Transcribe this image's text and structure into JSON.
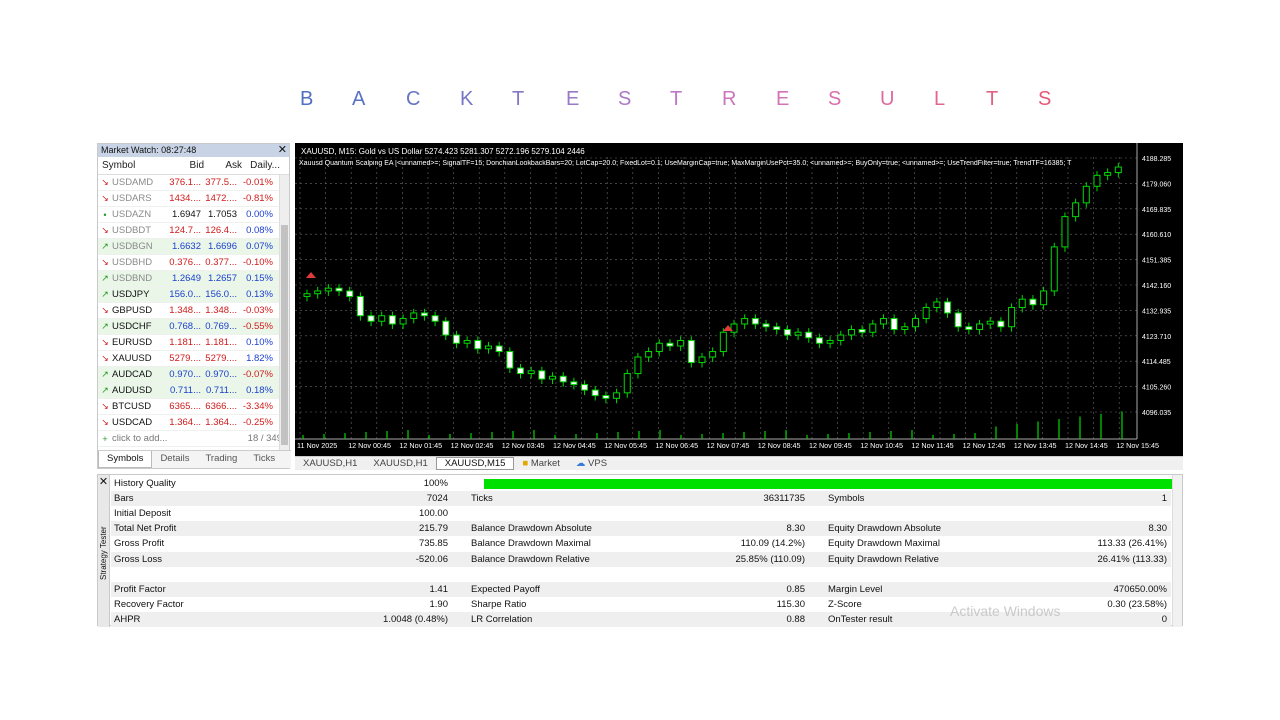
{
  "heading": {
    "letters": [
      "B",
      "A",
      "C",
      "K",
      "T",
      "E",
      "S",
      "T",
      "R",
      "E",
      "S",
      "U",
      "L",
      "T",
      "S"
    ],
    "colors": [
      "#4f6fc0",
      "#5a70c2",
      "#6774c4",
      "#7577c6",
      "#8579c6",
      "#9a7ac8",
      "#ab79c8",
      "#bb78c6",
      "#c876bf",
      "#d274b7",
      "#d86fac",
      "#df6a9f",
      "#e26592",
      "#e36084",
      "#e55a78"
    ]
  },
  "market_watch": {
    "title": "Market Watch: 08:27:48",
    "close": "✕",
    "columns": [
      "Symbol",
      "Bid",
      "Ask",
      "Daily..."
    ],
    "rows": [
      {
        "symbol": "USDAMD",
        "bid": "376.1...",
        "ask": "377.5...",
        "change": "-0.01%",
        "dir": "down"
      },
      {
        "symbol": "USDARS",
        "bid": "1434....",
        "ask": "1472....",
        "change": "-0.81%",
        "dir": "down"
      },
      {
        "symbol": "USDAZN",
        "bid": "1.6947",
        "ask": "1.7053",
        "change": "0.00%",
        "dir": "flat"
      },
      {
        "symbol": "USDBDT",
        "bid": "124.7...",
        "ask": "126.4...",
        "change": "0.08%",
        "dir": "down"
      },
      {
        "symbol": "USDBGN",
        "bid": "1.6632",
        "ask": "1.6696",
        "change": "0.07%",
        "dir": "up"
      },
      {
        "symbol": "USDBHD",
        "bid": "0.376...",
        "ask": "0.377...",
        "change": "-0.10%",
        "dir": "down"
      },
      {
        "symbol": "USDBND",
        "bid": "1.2649",
        "ask": "1.2657",
        "change": "0.15%",
        "dir": "up"
      },
      {
        "symbol": "USDJPY",
        "bid": "156.0...",
        "ask": "156.0...",
        "change": "0.13%",
        "dir": "up"
      },
      {
        "symbol": "GBPUSD",
        "bid": "1.348...",
        "ask": "1.348...",
        "change": "-0.03%",
        "dir": "down"
      },
      {
        "symbol": "USDCHF",
        "bid": "0.768...",
        "ask": "0.769...",
        "change": "-0.55%",
        "dir": "up"
      },
      {
        "symbol": "EURUSD",
        "bid": "1.181...",
        "ask": "1.181...",
        "change": "0.10%",
        "dir": "down"
      },
      {
        "symbol": "XAUUSD",
        "bid": "5279....",
        "ask": "5279....",
        "change": "1.82%",
        "dir": "down"
      },
      {
        "symbol": "AUDCAD",
        "bid": "0.970...",
        "ask": "0.970...",
        "change": "-0.07%",
        "dir": "up"
      },
      {
        "symbol": "AUDUSD",
        "bid": "0.711...",
        "ask": "0.711...",
        "change": "0.18%",
        "dir": "up"
      },
      {
        "symbol": "BTCUSD",
        "bid": "6365....",
        "ask": "6366....",
        "change": "-3.34%",
        "dir": "down"
      },
      {
        "symbol": "USDCAD",
        "bid": "1.364...",
        "ask": "1.364...",
        "change": "-0.25%",
        "dir": "down"
      }
    ],
    "add_label": "click to add...",
    "count": "18 / 349",
    "tabs": [
      "Symbols",
      "Details",
      "Trading",
      "Ticks"
    ]
  },
  "chart": {
    "title": "XAUUSD, M15:  Gold vs US Dollar  5274.423 5281.307 5272.196 5279.104  2446",
    "params": "Xauusd Quantum Scalping EA [<unnamed>=; SignalTF=15; DonchianLookbackBars=20; LotCap=20.0; FixedLot=0.1; UseMarginCap=true; MaxMarginUsePct=35.0; <unnamed>=; BuyOnly=true; <unnamed>=; UseTrendFilter=true; TrendTF=16385; T",
    "price_levels": [
      "4188.285",
      "4179.060",
      "4169.835",
      "4160.610",
      "4151.385",
      "4142.160",
      "4132.935",
      "4123.710",
      "4114.485",
      "4105.260",
      "4096.035"
    ],
    "time_labels": [
      "11 Nov 2025",
      "12 Nov 00:45",
      "12 Nov 01:45",
      "12 Nov 02:45",
      "12 Nov 03:45",
      "12 Nov 04:45",
      "12 Nov 05:45",
      "12 Nov 06:45",
      "12 Nov 07:45",
      "12 Nov 08:45",
      "12 Nov 09:45",
      "12 Nov 10:45",
      "12 Nov 11:45",
      "12 Nov 12:45",
      "12 Nov 13:45",
      "12 Nov 14:45",
      "12 Nov 15:45"
    ],
    "candles": [
      4139,
      4140,
      4141,
      4140,
      4138,
      4131,
      4129,
      4131,
      4128,
      4130,
      4132,
      4131,
      4129,
      4124,
      4121,
      4122,
      4119,
      4120,
      4118,
      4112,
      4110,
      4111,
      4108,
      4109,
      4107,
      4106,
      4104,
      4102,
      4101,
      4103,
      4110,
      4116,
      4118,
      4121,
      4120,
      4122,
      4114,
      4116,
      4118,
      4125,
      4128,
      4130,
      4128,
      4127,
      4126,
      4124,
      4125,
      4123,
      4121,
      4122,
      4124,
      4126,
      4125,
      4128,
      4130,
      4126,
      4127,
      4130,
      4134,
      4136,
      4132,
      4127,
      4126,
      4128,
      4129,
      4127,
      4134,
      4137,
      4135,
      4140,
      4156,
      4167,
      4172,
      4178,
      4182,
      4183,
      4185
    ]
  },
  "chart_tabs": [
    "XAUUSD,H1",
    "XAUUSD,H1",
    "XAUUSD,M15",
    "Market",
    "VPS"
  ],
  "tester": {
    "close": "✕",
    "side_label": "Strategy Tester",
    "rows": [
      {
        "c1": "History Quality",
        "v1": "100%",
        "c2": "",
        "v2": "",
        "c3": "",
        "v3": ""
      },
      {
        "c1": "Bars",
        "v1": "7024",
        "c2": "Ticks",
        "v2": "36311735",
        "c3": "Symbols",
        "v3": "1"
      },
      {
        "c1": "Initial Deposit",
        "v1": "100.00",
        "c2": "",
        "v2": "",
        "c3": "",
        "v3": ""
      },
      {
        "c1": "Total Net Profit",
        "v1": "215.79",
        "c2": "Balance Drawdown Absolute",
        "v2": "8.30",
        "c3": "Equity Drawdown Absolute",
        "v3": "8.30"
      },
      {
        "c1": "Gross Profit",
        "v1": "735.85",
        "c2": "Balance Drawdown Maximal",
        "v2": "110.09  (14.2%)",
        "c3": "Equity Drawdown Maximal",
        "v3": "113.33 (26.41%)"
      },
      {
        "c1": "Gross Loss",
        "v1": "-520.06",
        "c2": "Balance Drawdown Relative",
        "v2": "25.85% (110.09)",
        "c3": "Equity Drawdown Relative",
        "v3": "26.41% (113.33)"
      },
      {
        "c1": "",
        "v1": "",
        "c2": "",
        "v2": "",
        "c3": "",
        "v3": ""
      },
      {
        "c1": "Profit Factor",
        "v1": "1.41",
        "c2": "Expected Payoff",
        "v2": "0.85",
        "c3": "Margin Level",
        "v3": "470650.00%"
      },
      {
        "c1": "Recovery Factor",
        "v1": "1.90",
        "c2": "Sharpe Ratio",
        "v2": "115.30",
        "c3": "Z-Score",
        "v3": "0.30 (23.58%)"
      },
      {
        "c1": "AHPR",
        "v1": "1.0048 (0.48%)",
        "c2": "LR Correlation",
        "v2": "0.88",
        "c3": "OnTester result",
        "v3": "0"
      }
    ]
  },
  "watermark": "Activate Windows"
}
